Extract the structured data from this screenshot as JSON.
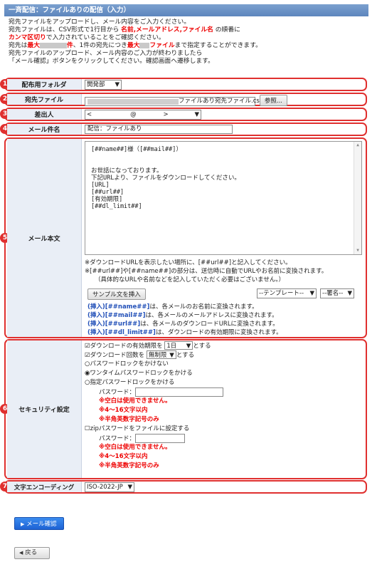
{
  "header": {
    "title": "一斉配信：ファイルありの配信（入力）"
  },
  "intro": {
    "l1": "宛先ファイルをアップロードし、メール内容をご入力ください。",
    "l2a": "宛先ファイルは、CSV形式で1行目から ",
    "l2b": "名前,メールアドレス,ファイル名",
    "l2c": " の順番に",
    "l3a": "カンマ区切り",
    "l3b": "で入力されていることをご確認ください。",
    "l4a": "宛先は",
    "l4b": "最大",
    "l4c": "件",
    "l4d": "、1件の宛先につき",
    "l4e": "最大",
    "l4f": "ファイル",
    "l4g": "まで指定することができます。",
    "l5": "宛先ファイルのアップロード、メール内容のご入力が終わりましたら",
    "l6": "「メール確認」ボタンをクリックしてください。確認画面へ遷移します。"
  },
  "form": {
    "folder": {
      "num": "1",
      "label": "配布用フォルダ",
      "value": "開発部"
    },
    "file": {
      "num": "2",
      "label": "宛先ファイル",
      "filename": "ファイルあり宛先ファイル.csv",
      "browse": "参照..."
    },
    "sender": {
      "num": "3",
      "label": "差出人",
      "value": "<                    @              >"
    },
    "subject": {
      "num": "4",
      "label": "メール件名",
      "value": "配信：ファイルあり"
    },
    "body": {
      "num": "5",
      "label": "メール本文",
      "text": "[##name##]様（[##mail##]）\n\n\nお世話になっております。\n下記URLより、ファイルをダウンロードしてください。\n[URL]\n[##url##]\n[有効期限]\n[##dl_limit##]",
      "note1": "※ダウンロードURLを表示したい場所に、[##url##]と記入してください。",
      "note2": "※[##url##]や[##name##]の部分は、送信時に自動でURLやお名前に変換されます。",
      "note3": "（具体的なURLや名前などを記入していただく必要はございません。）",
      "sample_button": "サンプル文を挿入",
      "template_select": "--テンプレート--",
      "signature_select": "--署名--",
      "inserts": [
        {
          "tag": "(挿入)[##name##]",
          "desc": "は、各メールのお名前に変換されます。"
        },
        {
          "tag": "(挿入)[##mail##]",
          "desc": "は、各メールのメールアドレスに変換されます。"
        },
        {
          "tag": "(挿入)[##url##]",
          "desc": "は、各メールのダウンロードURLに変換されます。"
        },
        {
          "tag": "(挿入)[##dl_limit##]",
          "desc": "は、ダウンロードの有効期限に変換されます。"
        }
      ]
    },
    "security": {
      "num": "6",
      "label": "セキュリティ設定",
      "dl_period_a": "ダウンロードの有効期限を",
      "dl_period_value": "1日",
      "dl_period_b": "とする",
      "dl_count_a": "ダウンロード回数を",
      "dl_count_value": "無制限",
      "dl_count_b": "とする",
      "opt_none": "パスワードロックをかけない",
      "opt_onetime": "ワンタイムパスワードロックをかける",
      "opt_fixed": "指定パスワードロックをかける",
      "pw_label": "パスワード：",
      "rule1": "※空白は使用できません。",
      "rule2": "※4～16文字以内",
      "rule3": "※半角英数字記号のみ",
      "zip_label": "zipパスワードをファイルに設定する",
      "zip_pw_label": "パスワード：",
      "zrule1": "※空白は使用できません。",
      "zrule2": "※4～16文字以内",
      "zrule3": "※半角英数字記号のみ"
    },
    "encoding": {
      "num": "7",
      "label": "文字エンコーディング",
      "value": "ISO-2022-JP"
    }
  },
  "actions": {
    "confirm": "メール確認",
    "back": "戻る"
  },
  "colors": {
    "accent": "#5d86bd",
    "annotation": "#e0302f",
    "warning": "#e00000"
  }
}
